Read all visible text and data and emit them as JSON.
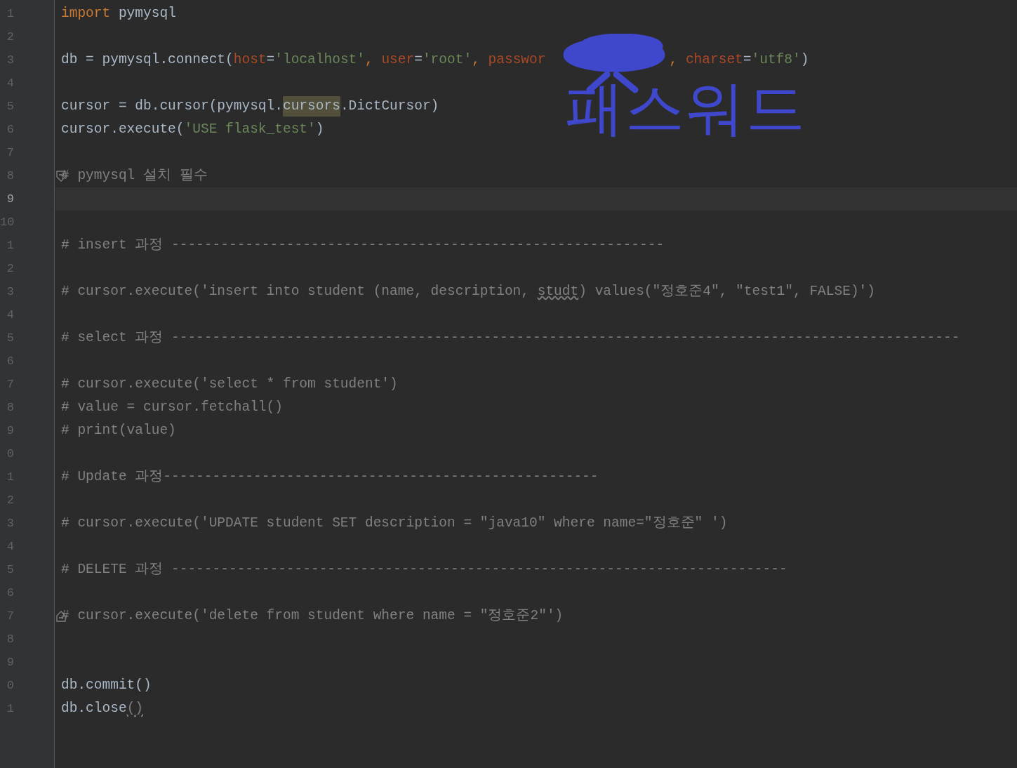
{
  "editor": {
    "lines": [
      {
        "number": "1",
        "current": false,
        "kind": "plain",
        "tokens": [
          {
            "text": "import",
            "kind": "keyword"
          },
          {
            "text": " pymysql",
            "kind": "plain"
          }
        ]
      },
      {
        "number": "2",
        "current": false,
        "kind": "plain"
      },
      {
        "number": "3",
        "current": false,
        "kind": "plain",
        "tokens": [
          {
            "text": "db = pymysql.connect(",
            "kind": "plain"
          },
          {
            "text": "host",
            "kind": "param"
          },
          {
            "text": "=",
            "kind": "plain"
          },
          {
            "text": "'localhost'",
            "kind": "string"
          },
          {
            "text": ", ",
            "kind": "keyword"
          },
          {
            "text": "user",
            "kind": "param"
          },
          {
            "text": "=",
            "kind": "plain"
          },
          {
            "text": "'root'",
            "kind": "string"
          },
          {
            "text": ", ",
            "kind": "keyword"
          },
          {
            "text": "passwor",
            "kind": "param"
          },
          {
            "kind": "redacted"
          },
          {
            "text": ", ",
            "kind": "keyword"
          },
          {
            "text": "charset",
            "kind": "param"
          },
          {
            "text": "=",
            "kind": "plain"
          },
          {
            "text": "'utf8'",
            "kind": "string"
          },
          {
            "text": ")",
            "kind": "plain"
          }
        ]
      },
      {
        "number": "4",
        "current": false,
        "kind": "plain"
      },
      {
        "number": "5",
        "current": false,
        "kind": "plain",
        "tokens": [
          {
            "text": "cursor = db.cursor(pymysql.",
            "kind": "plain"
          },
          {
            "text": "cursors",
            "kind": "highlight"
          },
          {
            "text": ".DictCursor)",
            "kind": "plain"
          }
        ]
      },
      {
        "number": "6",
        "current": false,
        "kind": "plain",
        "tokens": [
          {
            "text": "cursor.execute(",
            "kind": "plain"
          },
          {
            "text": "'USE flask_test'",
            "kind": "string"
          },
          {
            "text": ")",
            "kind": "plain"
          }
        ]
      },
      {
        "number": "7",
        "current": false,
        "kind": "plain"
      },
      {
        "number": "8",
        "current": false,
        "kind": "fold_start",
        "tokens": [
          {
            "text": "# pymysql 설치 필수",
            "kind": "comment"
          }
        ]
      },
      {
        "number": "9",
        "current": true,
        "kind": "plain"
      },
      {
        "number": "10",
        "current": false,
        "kind": "plain"
      },
      {
        "number": "1",
        "current": false,
        "kind": "plain",
        "tokens": [
          {
            "text": "# insert 과정 ------------------------------------------------------------",
            "kind": "comment"
          }
        ]
      },
      {
        "number": "2",
        "current": false,
        "kind": "plain"
      },
      {
        "number": "3",
        "current": false,
        "kind": "plain",
        "tokens": [
          {
            "text": "# cursor.execute('insert into student (name, description, ",
            "kind": "comment"
          },
          {
            "text": "studt",
            "kind": "typo"
          },
          {
            "text": ") values(\"정호준4\", \"test1\", FALSE)')",
            "kind": "comment"
          }
        ]
      },
      {
        "number": "4",
        "current": false,
        "kind": "plain"
      },
      {
        "number": "5",
        "current": false,
        "kind": "plain",
        "tokens": [
          {
            "text": "# select 과정 ------------------------------------------------------------------------------------------------",
            "kind": "comment"
          }
        ]
      },
      {
        "number": "6",
        "current": false,
        "kind": "plain"
      },
      {
        "number": "7",
        "current": false,
        "kind": "plain",
        "tokens": [
          {
            "text": "# cursor.execute('select * from student')",
            "kind": "comment"
          }
        ]
      },
      {
        "number": "8",
        "current": false,
        "kind": "plain",
        "tokens": [
          {
            "text": "# value = cursor.fetchall()",
            "kind": "comment"
          }
        ]
      },
      {
        "number": "9",
        "current": false,
        "kind": "plain",
        "tokens": [
          {
            "text": "# print(value)",
            "kind": "comment"
          }
        ]
      },
      {
        "number": "0",
        "current": false,
        "kind": "plain"
      },
      {
        "number": "1",
        "current": false,
        "kind": "plain",
        "tokens": [
          {
            "text": "# Update 과정-----------------------------------------------------",
            "kind": "comment"
          }
        ]
      },
      {
        "number": "2",
        "current": false,
        "kind": "plain"
      },
      {
        "number": "3",
        "current": false,
        "kind": "plain",
        "tokens": [
          {
            "text": "# cursor.execute('UPDATE student SET description = \"java10\" where name=\"정호준\" ')",
            "kind": "comment"
          }
        ]
      },
      {
        "number": "4",
        "current": false,
        "kind": "plain"
      },
      {
        "number": "5",
        "current": false,
        "kind": "plain",
        "tokens": [
          {
            "text": "# DELETE 과정 ---------------------------------------------------------------------------",
            "kind": "comment"
          }
        ]
      },
      {
        "number": "6",
        "current": false,
        "kind": "plain"
      },
      {
        "number": "7",
        "current": false,
        "kind": "fold_end",
        "tokens": [
          {
            "text": "# cursor.execute('delete from student where name = \"정호준2\"')",
            "kind": "comment"
          }
        ]
      },
      {
        "number": "8",
        "current": false,
        "kind": "plain"
      },
      {
        "number": "9",
        "current": false,
        "kind": "plain"
      },
      {
        "number": "0",
        "current": false,
        "kind": "plain",
        "tokens": [
          {
            "text": "db.commit()",
            "kind": "plain"
          }
        ]
      },
      {
        "number": "1",
        "current": false,
        "kind": "plain",
        "tokens": [
          {
            "text": "db.close",
            "kind": "plain"
          },
          {
            "text": "()",
            "kind": "typo"
          }
        ]
      }
    ]
  },
  "annotation": {
    "text": "패스워드"
  }
}
